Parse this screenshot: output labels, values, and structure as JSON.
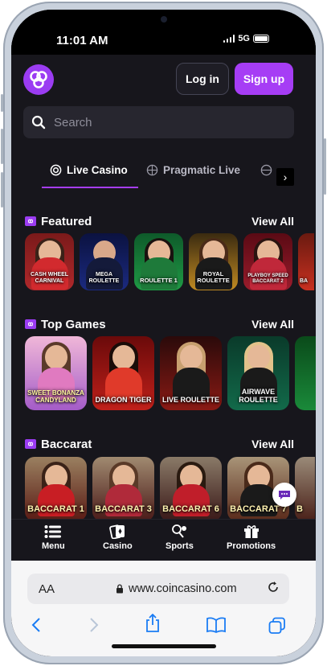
{
  "status_bar": {
    "time": "11:01 AM",
    "network": "5G"
  },
  "header": {
    "login_label": "Log in",
    "signup_label": "Sign up"
  },
  "search": {
    "placeholder": "Search"
  },
  "tabs": [
    {
      "label": "Live Casino",
      "icon": "live-casino-icon",
      "active": true
    },
    {
      "label": "Pragmatic Live",
      "icon": "pragmatic-icon",
      "active": false
    }
  ],
  "sections": {
    "featured": {
      "title": "Featured",
      "view_all": "View All",
      "games": [
        "CASH WHEEL CARNIVAL",
        "MEGA ROULETTE",
        "ROULETTE 1",
        "ROYAL ROULETTE",
        "PLAYBOY SPEED BACCARAT 2",
        "BA"
      ]
    },
    "top_games": {
      "title": "Top Games",
      "view_all": "View All",
      "games": [
        "SWEET BONANZA CANDYLAND",
        "DRAGON TIGER",
        "LIVE ROULETTE",
        "AIRWAVE ROULETTE",
        ""
      ]
    },
    "baccarat": {
      "title": "Baccarat",
      "view_all": "View All",
      "games": [
        "BACCARAT 1",
        "BACCARAT 3",
        "BACCARAT 6",
        "BACCARAT 7",
        "B"
      ]
    }
  },
  "bottom_nav": [
    {
      "label": "Menu",
      "icon": "menu-icon"
    },
    {
      "label": "Casino",
      "icon": "cards-icon"
    },
    {
      "label": "Sports",
      "icon": "sports-icon"
    },
    {
      "label": "Promotions",
      "icon": "gift-icon"
    }
  ],
  "browser": {
    "aa": "AA",
    "url": "www.coincasino.com"
  },
  "colors": {
    "accent": "#a63df5",
    "background": "#17161c",
    "safari_blue": "#1a7cf4"
  }
}
